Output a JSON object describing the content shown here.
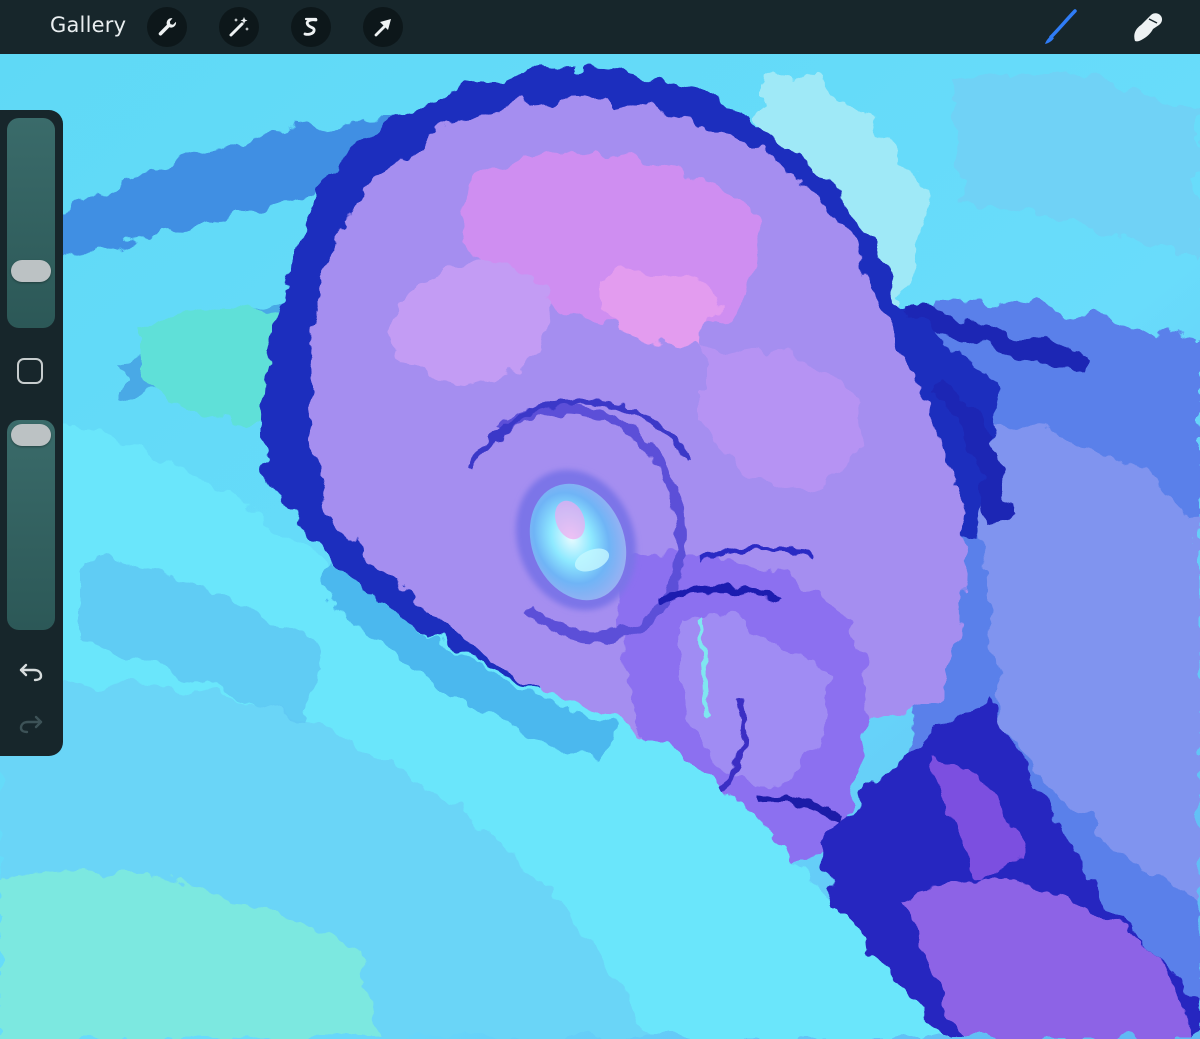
{
  "toolbar": {
    "gallery_label": "Gallery",
    "actions_icon": "wrench-icon",
    "adjustments_icon": "magic-wand-icon",
    "selection_icon": "selection-s-icon",
    "transform_icon": "arrow-cursor-icon",
    "brush_icon": "brush-icon",
    "smudge_icon": "smudge-finger-icon",
    "active_tool_color": "#2f7cf6"
  },
  "sidebar": {
    "brush_size_level": 0.26,
    "opacity_level": 0.93,
    "modify_icon": "square-icon",
    "undo_icon": "undo-arrow-icon",
    "redo_icon": "redo-arrow-icon"
  },
  "canvas": {
    "artwork": "painting"
  },
  "colors": {
    "toolbar_bg": "#17262b",
    "slider_track": "#34605f",
    "slider_thumb": "#bcc2c4"
  }
}
